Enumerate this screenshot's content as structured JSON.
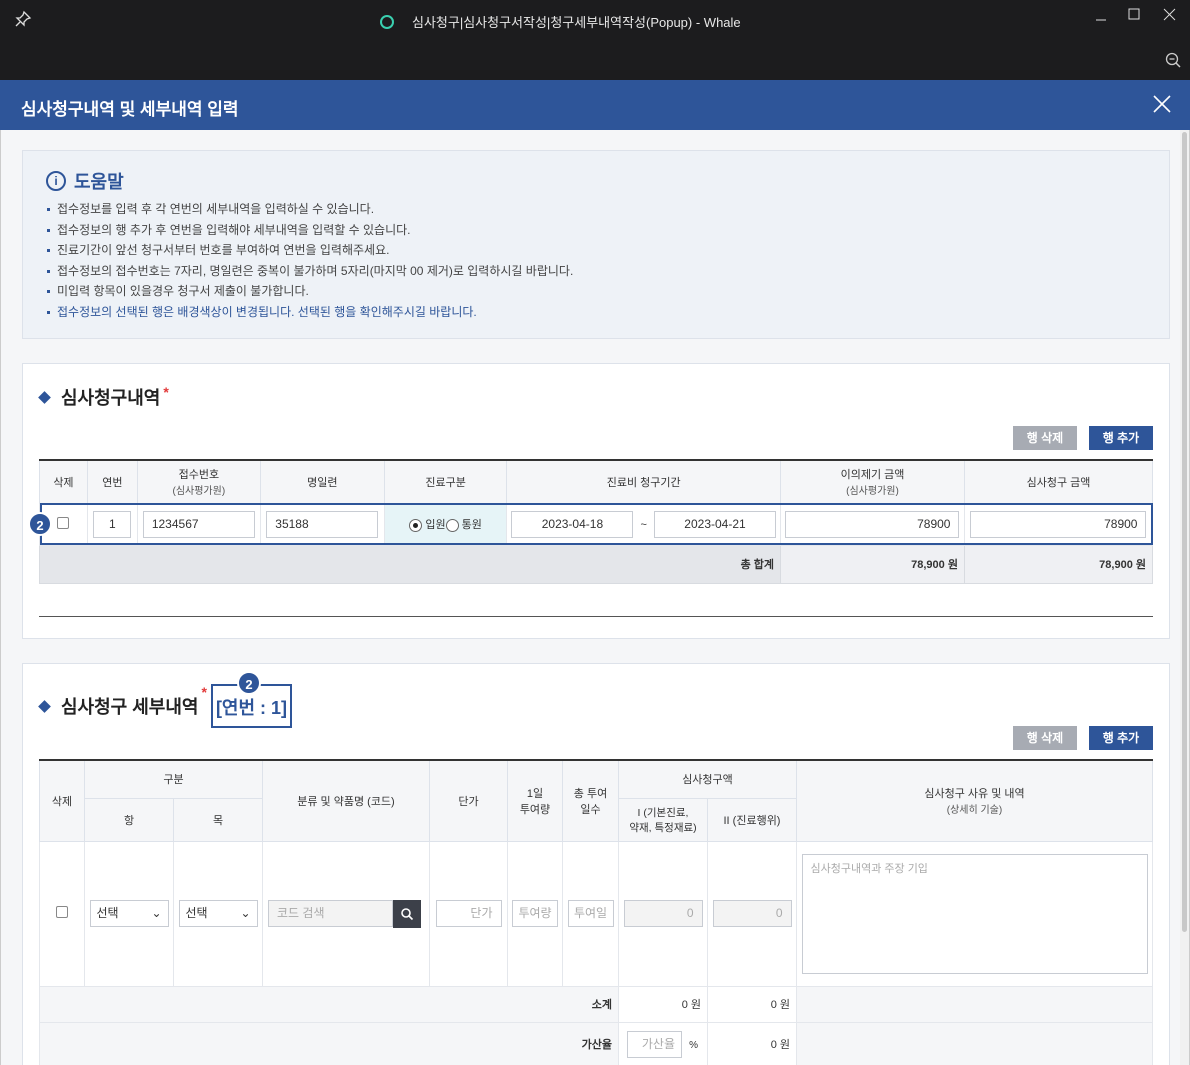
{
  "window": {
    "title": "심사청구|심사청구서작성|청구세부내역작성(Popup) - Whale"
  },
  "header": {
    "title": "심사청구내역 및 세부내역 입력"
  },
  "help": {
    "title": "도움말",
    "items": [
      "접수정보를 입력 후 각 연번의 세부내역을 입력하실 수 있습니다.",
      "접수정보의 행 추가 후 연번을 입력해야 세부내역을 입력할 수 있습니다.",
      "진료기간이 앞선 청구서부터 번호를 부여하여 연번을 입력해주세요.",
      "접수정보의 접수번호는 7자리, 명일련은 중복이 불가하며 5자리(마지막 00 제거)로 입력하시길 바랍니다.",
      "미입력 항목이 있을경우 청구서 제출이 불가합니다.",
      "접수정보의 선택된 행은 배경색상이 변경됩니다. 선택된 행을 확인해주시길 바랍니다."
    ]
  },
  "claim": {
    "title": "심사청구내역",
    "required_mark": "*",
    "delete_row": "행 삭제",
    "add_row": "행 추가",
    "headers": {
      "del": "삭제",
      "seq": "연번",
      "receipt": "접수번호",
      "receipt_sub": "(심사평가원)",
      "serial": "명일련",
      "type": "진료구분",
      "period": "진료비 청구기간",
      "objection": "이의제기 금액",
      "objection_sub": "(심사평가원)",
      "amount": "심사청구 금액"
    },
    "row": {
      "badge": "2",
      "seq": "1",
      "receipt": "1234567",
      "serial": "35188",
      "inpatient": "입원",
      "outpatient": "통원",
      "start": "2023-04-18",
      "tilde": "~",
      "end": "2023-04-21",
      "objection": "78900",
      "amount": "78900"
    },
    "total_label": "총 합계",
    "total_objection": "78,900 원",
    "total_amount": "78,900 원"
  },
  "detail": {
    "title": "심사청구 세부내역",
    "required_mark": "*",
    "badge": "2",
    "seq_label": "[연번 : 1]",
    "delete_row": "행 삭제",
    "add_row": "행 추가",
    "headers": {
      "del": "삭제",
      "category": "구분",
      "item": "항",
      "sub": "목",
      "drug": "분류 및 약품명 (코드)",
      "unit_price": "단가",
      "daily_dose": "1일\n투여량",
      "total_days": "총 투여\n일수",
      "claim_amount": "심사청구액",
      "amount1": "I (기본진료,\n약재, 특정재료)",
      "amount2": "II (진료행위)",
      "reason": "심사청구 사유 및 내역",
      "reason_sub": "(상세히 기술)"
    },
    "row": {
      "item_select": "선택",
      "sub_select": "선택",
      "code_placeholder": "코드 검색",
      "unit_placeholder": "단가",
      "dose_placeholder": "투여량",
      "days_placeholder": "투여일",
      "amount1": "0",
      "amount2": "0",
      "reason_placeholder": "심사청구내역과 주장 기입"
    },
    "subtotal_label": "소계",
    "subtotal1": "0 원",
    "subtotal2": "0 원",
    "surcharge_label": "가산율",
    "surcharge_placeholder": "가산율",
    "percent": "%",
    "surcharge2": "0 원"
  }
}
